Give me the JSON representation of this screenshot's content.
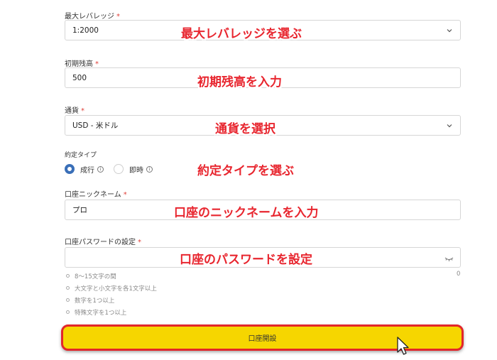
{
  "form": {
    "leverage": {
      "label": "最大レバレッジ",
      "value": "1:2000",
      "annotation": "最大レバレッジを選ぶ"
    },
    "balance": {
      "label": "初期残高",
      "value": "500",
      "annotation": "初期残高を入力"
    },
    "currency": {
      "label": "通貨",
      "value": "USD - 米ドル",
      "annotation": "通貨を選択"
    },
    "execution": {
      "label": "約定タイプ",
      "options": [
        {
          "label": "成行",
          "selected": true
        },
        {
          "label": "即時",
          "selected": false
        }
      ],
      "annotation": "約定タイプを選ぶ"
    },
    "nickname": {
      "label": "口座ニックネーム",
      "value": "プロ",
      "annotation": "口座のニックネームを入力"
    },
    "password": {
      "label": "口座パスワードの設定",
      "value": "",
      "annotation": "口座のパスワードを設定",
      "counter": "0",
      "rules": [
        "8～15文字の間",
        "大文字と小文字を各1文字以上",
        "数字を1つ以上",
        "特殊文字を1つ以上"
      ]
    },
    "required_mark": "*",
    "info_glyph": "i",
    "submit_label": "口座開設"
  },
  "colors": {
    "accent_radio": "#3a6fb8",
    "required": "#e0413a",
    "annotation": "#e8262f",
    "button_fill": "#f6d600",
    "button_border": "#e3262a"
  }
}
